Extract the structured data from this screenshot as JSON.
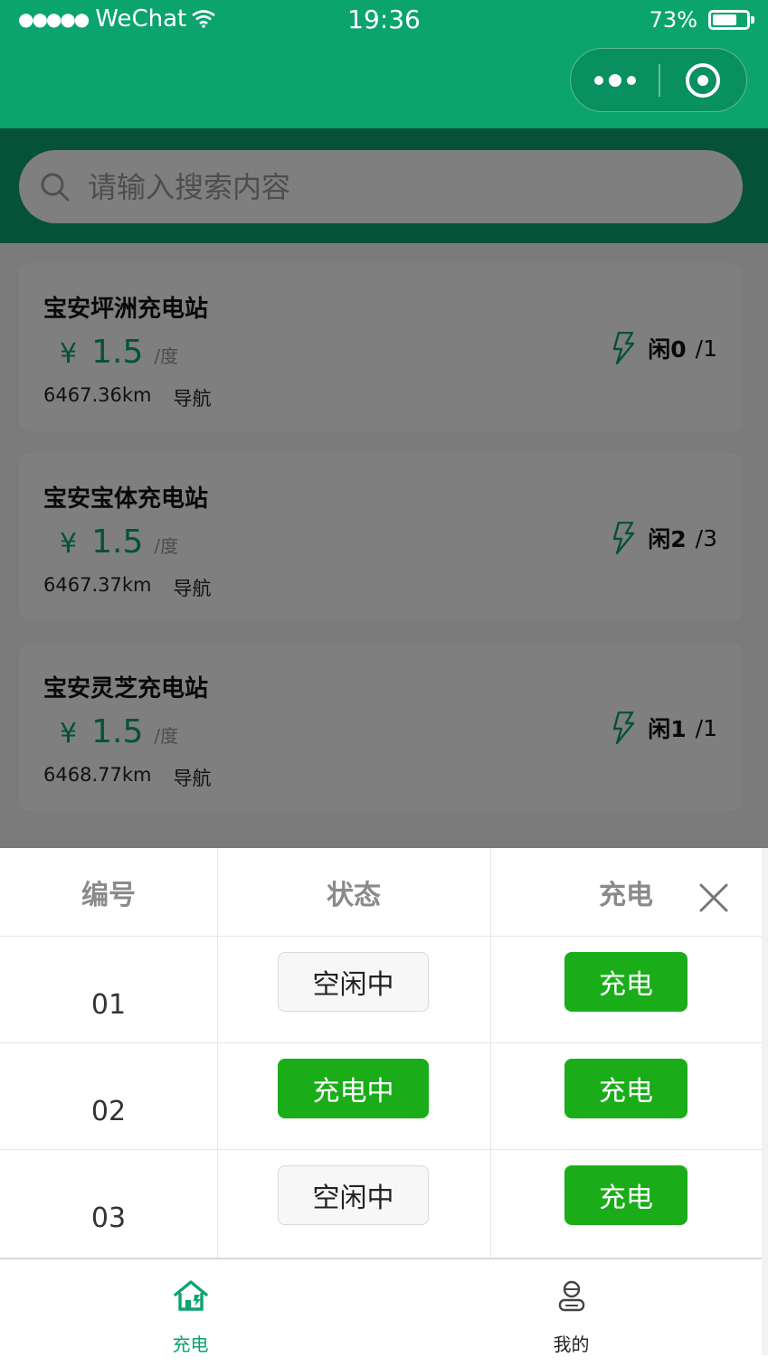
{
  "status_bar": {
    "signal": "●●●●●",
    "carrier": "WeChat",
    "time": "19:36",
    "battery": "73%",
    "battery_level": 0.73
  },
  "search": {
    "placeholder": "请输入搜索内容",
    "icon": "search-icon"
  },
  "stations": [
    {
      "name": "宝安坪洲充电站",
      "yen": "¥",
      "price": "1.5",
      "unit": "/度",
      "distance": "6467.36km",
      "nav": "导航",
      "free": "闲0",
      "total": "/1"
    },
    {
      "name": "宝安宝体充电站",
      "yen": "¥",
      "price": "1.5",
      "unit": "/度",
      "distance": "6467.37km",
      "nav": "导航",
      "free": "闲2",
      "total": "/3"
    },
    {
      "name": "宝安灵芝充电站",
      "yen": "¥",
      "price": "1.5",
      "unit": "/度",
      "distance": "6468.77km",
      "nav": "导航",
      "free": "闲1",
      "total": "/1"
    }
  ],
  "sheet": {
    "headers": {
      "id": "编号",
      "status": "状态",
      "charge": "充电"
    },
    "rows": [
      {
        "id": "01",
        "status": "空闲中",
        "status_type": "idle",
        "charge": "充电"
      },
      {
        "id": "02",
        "status": "充电中",
        "status_type": "charging",
        "charge": "充电"
      },
      {
        "id": "03",
        "status": "空闲中",
        "status_type": "idle",
        "charge": "充电"
      }
    ]
  },
  "tabbar": {
    "tabs": [
      {
        "label": "充电",
        "icon": "home-charge-icon",
        "active": true
      },
      {
        "label": "我的",
        "icon": "user-icon",
        "active": false
      }
    ]
  },
  "colors": {
    "brand": "#0ba46e",
    "button_green": "#1aad19",
    "overlay": "rgba(0,0,0,0.5)"
  }
}
